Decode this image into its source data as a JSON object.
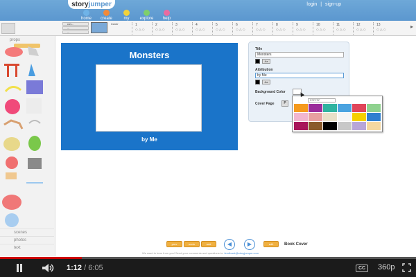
{
  "header": {
    "logo_prefix": "story",
    "logo_suffix": "jumper",
    "nav": [
      {
        "label": "home",
        "color": "#6fb3e8"
      },
      {
        "label": "create",
        "color": "#f18a3a"
      },
      {
        "label": "my",
        "color": "#f3d23a"
      },
      {
        "label": "explore",
        "color": "#7fcf6b"
      },
      {
        "label": "help",
        "color": "#e86ba0"
      }
    ],
    "login": "login",
    "separator": "|",
    "signup": "sign-up"
  },
  "strip": {
    "mini_rows": [
      "cov...",
      "...",
      "..."
    ],
    "cover_label": "Cover",
    "pages": [
      "1",
      "2",
      "3",
      "4",
      "5",
      "6",
      "7",
      "8",
      "9",
      "10",
      "11",
      "12",
      "13"
    ]
  },
  "left": {
    "props_label": "props",
    "tabs": [
      "scenes",
      "photos",
      "text"
    ]
  },
  "book": {
    "title": "Monsters",
    "attribution": "by Me",
    "background_color": "#1a74c9"
  },
  "panel": {
    "title_label": "Title",
    "title_value": "Monsters",
    "attribution_label": "Attribution",
    "attribution_value": "by Me",
    "aa_label": "Aa",
    "bg_color_label": "Background Color",
    "cover_page_label": "Cover Page"
  },
  "picker": {
    "hex": "FFFFFF",
    "colors": [
      "#f59a1d",
      "#9b2d9b",
      "#2fb3a0",
      "#4aa3e0",
      "#e0455a",
      "#8fd28f",
      "#f2b6cf",
      "#e8a0a0",
      "#e8e0c8",
      "#f5f5f5",
      "#f5d000",
      "#2f7fd0",
      "#a8155a",
      "#8a5a2a",
      "#000000",
      "#c8c8c8",
      "#b8a6d8",
      "#f5d8a0"
    ]
  },
  "bottom": {
    "btn1": "prev",
    "btn2": "undo",
    "btn3": "add",
    "btn4": "edit",
    "prev_arrow": "◀",
    "next_arrow": "▶",
    "book_cover": "Book Cover",
    "feedback_text": "We want to hear from you! Send your comments and questions to: ",
    "feedback_link": "feedback@storyjumper.com"
  },
  "player": {
    "current_time": "1:12",
    "duration": "6:05",
    "quality": "360p",
    "cc_label": "CC",
    "progress": 0.197
  }
}
